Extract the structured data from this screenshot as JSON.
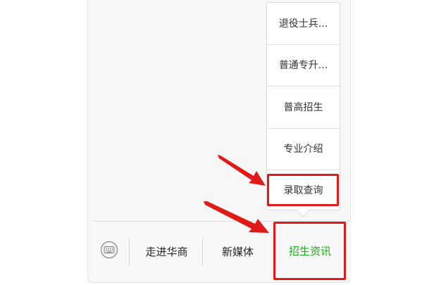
{
  "bottom_menu": {
    "tabs": [
      {
        "label": "走进华商"
      },
      {
        "label": "新媒体"
      },
      {
        "label": "招生资讯"
      }
    ],
    "active_tab_color": "#1aad19"
  },
  "submenu": {
    "items": [
      {
        "label": "退役士兵..."
      },
      {
        "label": "普通专升..."
      },
      {
        "label": "普高招生"
      },
      {
        "label": "专业介绍"
      },
      {
        "label": "录取查询"
      }
    ]
  },
  "icons": {
    "keyboard": "keyboard-icon",
    "arrows": "red-arrow-icon"
  },
  "colors": {
    "highlight": "#e01919",
    "active_tab": "#1aad19"
  }
}
